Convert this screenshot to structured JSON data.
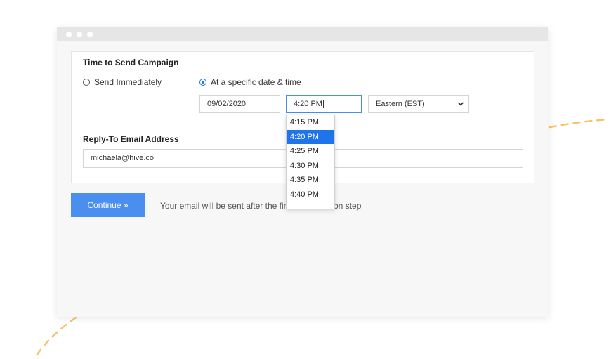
{
  "window": {
    "controls": [
      "dot-1",
      "dot-2",
      "dot-3"
    ]
  },
  "campaign": {
    "section_title": "Time to Send Campaign",
    "send_immediately_label": "Send Immediately",
    "specific_label": "At a specific date & time",
    "selected_option": "At a specific date & time",
    "date_value": "09/02/2020",
    "time_value": "4:20 PM",
    "timezone_value": "Eastern (EST)"
  },
  "time_dropdown": {
    "options": [
      "4:15 PM",
      "4:20 PM",
      "4:25 PM",
      "4:30 PM",
      "4:35 PM",
      "4:40 PM"
    ],
    "selected": "4:20 PM"
  },
  "reply_to": {
    "section_title": "Reply-To Email Address",
    "value": "michaela@hive.co"
  },
  "footer": {
    "continue_label": "Continue »",
    "hint": "Your email will be sent after the final confirmation step"
  },
  "colors": {
    "accent": "#4a8ef0",
    "selected_option_bg": "#1e74e8",
    "decoration_dash": "#f5c46a"
  },
  "icons": {
    "timezone_select": "chevron-down-icon"
  }
}
